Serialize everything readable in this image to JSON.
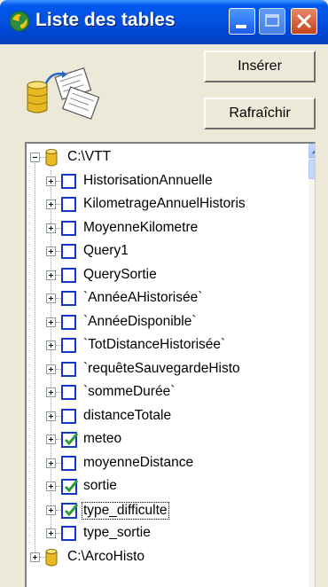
{
  "window": {
    "title": "Liste des tables",
    "title_color": "#ffffff",
    "titlebar_color": "#0054e3"
  },
  "toolbar": {
    "insert_label": "Insérer",
    "refresh_label": "Rafraîchir"
  },
  "tree": {
    "root": {
      "label": "C:\\VTT",
      "icon": "database-icon",
      "expanded": true
    },
    "children": [
      {
        "label": "HistorisationAnnuelle",
        "icon": "table-icon"
      },
      {
        "label": "KilometrageAnnuelHistoris",
        "icon": "table-icon"
      },
      {
        "label": "MoyenneKilometre",
        "icon": "table-icon"
      },
      {
        "label": "Query1",
        "icon": "table-icon"
      },
      {
        "label": "QuerySortie",
        "icon": "table-icon"
      },
      {
        "label": "`AnnéeAHistorisée`",
        "icon": "table-icon"
      },
      {
        "label": "`AnnéeDisponible`",
        "icon": "table-icon"
      },
      {
        "label": "`TotDistanceHistorisée`",
        "icon": "table-icon"
      },
      {
        "label": "`requêteSauvegardeHisto",
        "icon": "table-icon"
      },
      {
        "label": "`sommeDurée`",
        "icon": "table-icon"
      },
      {
        "label": "distanceTotale",
        "icon": "table-icon"
      },
      {
        "label": "meteo",
        "icon": "checked-table-icon"
      },
      {
        "label": "moyenneDistance",
        "icon": "table-icon"
      },
      {
        "label": "sortie",
        "icon": "checked-table-icon"
      },
      {
        "label": "type_difficulte",
        "icon": "checked-table-icon",
        "selected": true
      },
      {
        "label": "type_sortie",
        "icon": "table-icon"
      }
    ],
    "second_root": {
      "label": "C:\\ArcoHisto",
      "icon": "database-icon",
      "expanded": false
    }
  }
}
